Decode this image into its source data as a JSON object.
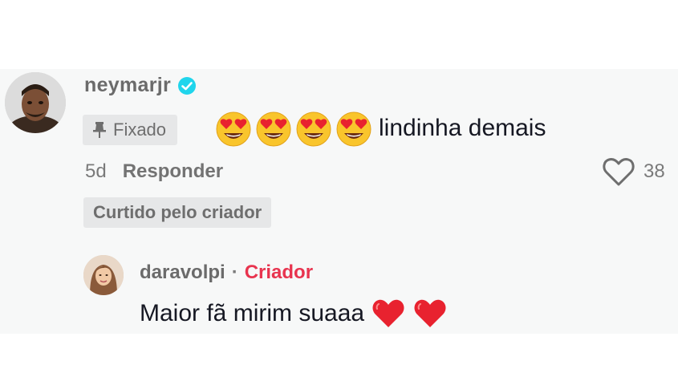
{
  "comment": {
    "username": "neymarjr",
    "pinned_label": "Fixado",
    "emoji_count": 4,
    "text": "lindinha demais",
    "age": "5d",
    "reply_label": "Responder",
    "like_count": "38",
    "liked_by_creator_label": "Curtido pelo criador"
  },
  "reply": {
    "username": "daravolpi",
    "separator": "·",
    "creator_label": "Criador",
    "text": "Maior fã mirim suaaa"
  },
  "icons": {
    "verified": "verified-badge-icon",
    "pin": "pin-icon",
    "emoji": "heart-eyes-emoji-icon",
    "like": "heart-outline-icon",
    "reply_emoji": "red-heart-emoji-icon"
  },
  "colors": {
    "panel_background": "#f7f8f8",
    "badge_background": "#e6e7e8",
    "verified_blue": "#20d5ec",
    "creator_red": "#e8344f",
    "heart_red": "#e8222f",
    "text_dark": "#161823",
    "text_muted": "#7a7a7a"
  }
}
